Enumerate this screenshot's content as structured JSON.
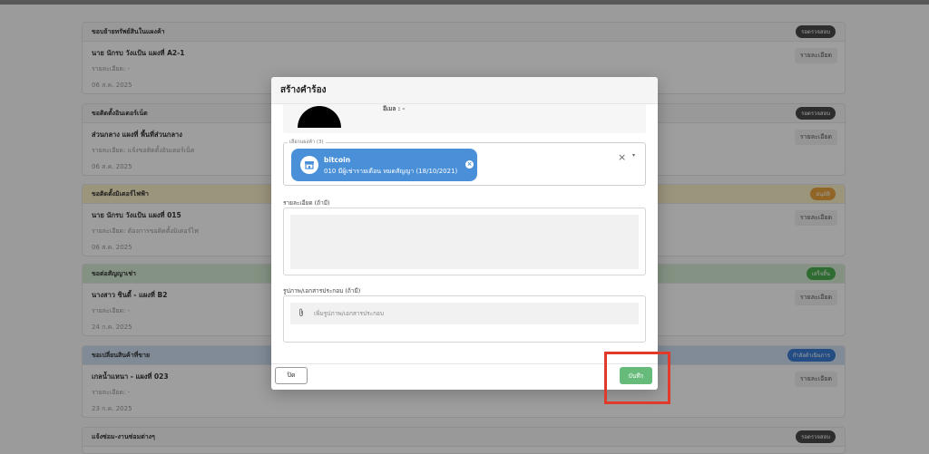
{
  "background": {
    "cards": [
      {
        "title": "ขอบย้ายทรัพย์สินในแผงค้า",
        "badge": "รอตรวจสอบ",
        "badge_color": "#4a4a4a",
        "line1": "นาย นักรบ วังแป้น แผงที่ A2-1",
        "line2": "รายละเอียด: -",
        "line3": "06 ส.ค. 2025",
        "detail": "รายละเอียด"
      },
      {
        "title": "ขอติดตั้งอินเตอร์เน็ต",
        "badge": "รอตรวจสอบ",
        "badge_color": "#4a4a4a",
        "line1": "ส่วนกลาง แผงที่ พื้นที่ส่วนกลาง",
        "line2": "รายละเอียด: แจ้งขอติดตั้งอินเตอร์เน็ต",
        "line3": "06 ส.ค. 2025",
        "detail": "รายละเอียด"
      },
      {
        "title": "ขอติดตั้งมิเตอร์ไฟฟ้า",
        "badge": "อนุมัติ",
        "badge_color": "#e8a33d",
        "line1": "นาย นักรบ วังแป้น แผงที่ 015",
        "line2": "รายละเอียด: ต้องการขอติดตั้งมิเตอร์ไฟ",
        "line3": "06 ส.ค. 2025",
        "detail": "รายละเอียด"
      },
      {
        "title": "ขอต่อสัญญาเช่า",
        "badge": "เสร็จสิ้น",
        "badge_color": "#4caf50",
        "line1": "นางสาว ซินดี้ - แผงที่ B2",
        "line2": "รายละเอียด: -",
        "line3": "24 ก.ค. 2025",
        "detail": "รายละเอียด"
      },
      {
        "title": "ขอเปลี่ยนสินค้าที่ขาย",
        "badge": "กำลังดำเนินการ",
        "badge_color": "#3b7fd4",
        "line1": "เกลน้ำแหนา - แผงที่ 023",
        "line2": "รายละเอียด: -",
        "line3": "23 ก.ค. 2025",
        "detail": "รายละเอียด"
      },
      {
        "title": "แจ้งซ่อม-งานซ่อมต่างๆ",
        "badge": "รอตรวจสอบ",
        "badge_color": "#4a4a4a",
        "line1": "",
        "line2": "",
        "line3": "",
        "detail": ""
      }
    ]
  },
  "modal": {
    "title": "สร้างคำร้อง",
    "email_label": "อีเมล : -",
    "stall_legend": "เลือกแผงค้า (3)",
    "chip_title": "bitcoin",
    "chip_subtitle": "010 มีผู้เช่ารายเดือน หมดสัญญา (18/10/2021)",
    "clear_symbol": "×",
    "caret_symbol": "▾",
    "detail_label": "รายละเอียด (ถ้ามี)",
    "attachment_label": "รูปภาพ/เอกสารประกอบ (ถ้ามี)",
    "attachment_placeholder": "เพิ่มรูปภาพ/เอกสารประกอบ",
    "close_label": "ปิด",
    "save_label": "บันทึก"
  },
  "colors": {
    "save": "#66bb7a",
    "chip": "#4a90d9",
    "highlight": "#e23a2a"
  }
}
